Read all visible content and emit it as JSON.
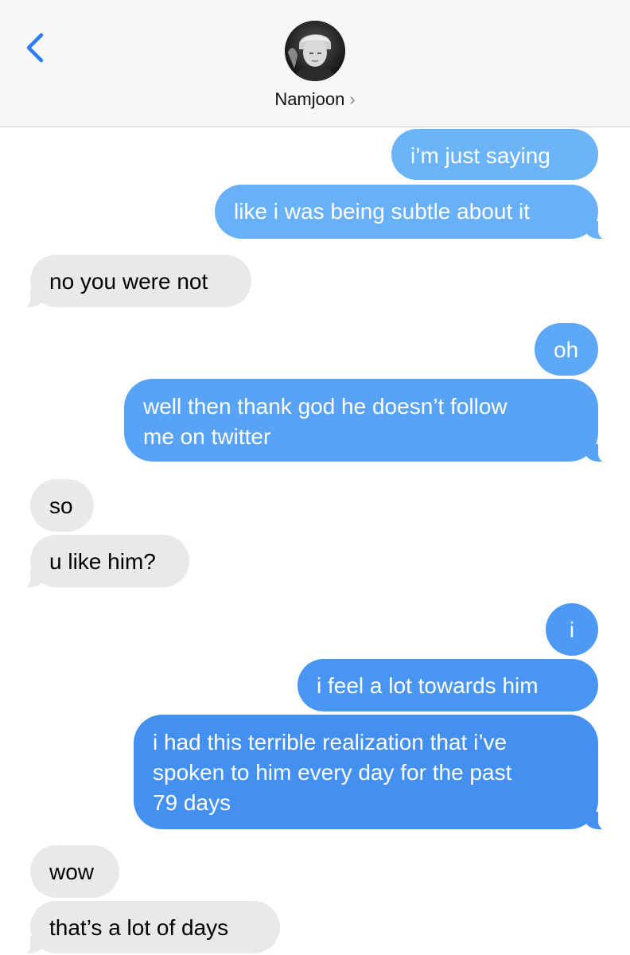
{
  "header": {
    "back_icon": "chevron-left-icon",
    "contact_name": "Namjoon",
    "chevron": "›",
    "avatar": "contact-photo"
  },
  "colors": {
    "sent_top": "#6cb4f8",
    "sent_bottom": "#3d8ef0",
    "received": "#e9e9eb",
    "accent": "#2f7cf6"
  },
  "messages": [
    {
      "from": "me",
      "text": "i’m just saying"
    },
    {
      "from": "me",
      "text": "like i was being subtle about it"
    },
    {
      "from": "them",
      "text": "no you were not"
    },
    {
      "from": "me",
      "text": "oh"
    },
    {
      "from": "me",
      "lines": [
        "well then thank god he doesn’t follow",
        "me on twitter"
      ]
    },
    {
      "from": "them",
      "text": "so"
    },
    {
      "from": "them",
      "text": "u like him?"
    },
    {
      "from": "me",
      "text": "i"
    },
    {
      "from": "me",
      "text": "i feel a lot towards him"
    },
    {
      "from": "me",
      "lines": [
        "i had this terrible realization that i’ve",
        "spoken to him every day for the past",
        "79 days"
      ]
    },
    {
      "from": "them",
      "text": "wow"
    },
    {
      "from": "them",
      "text": "that’s a lot of days"
    }
  ]
}
